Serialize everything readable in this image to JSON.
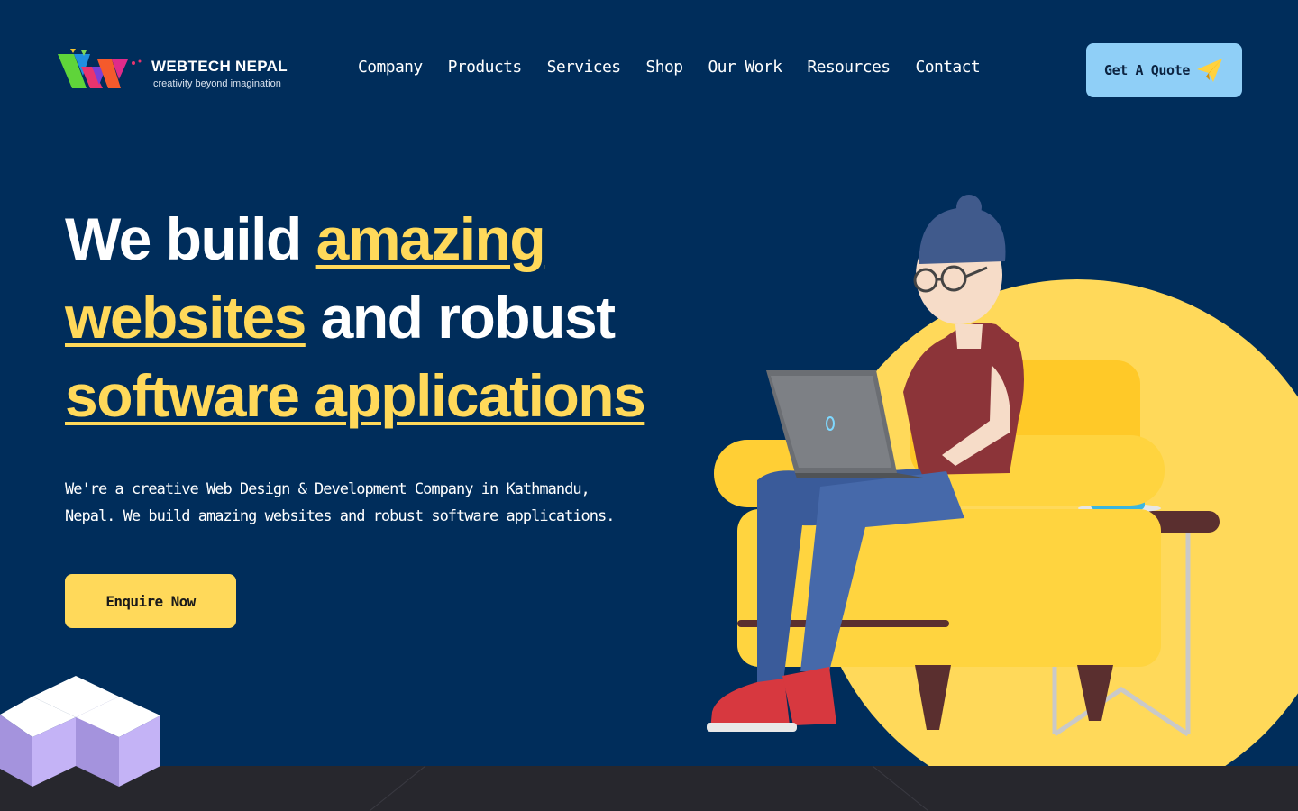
{
  "brand": {
    "name": "WEBTECH NEPAL",
    "tagline": "creativity beyond imagination"
  },
  "nav": {
    "items": [
      "Company",
      "Products",
      "Services",
      "Shop",
      "Our Work",
      "Resources",
      "Contact"
    ]
  },
  "header": {
    "quote_label": "Get A Quote",
    "quote_icon": "paper-plane-icon"
  },
  "hero": {
    "headline": {
      "part1": "We build ",
      "highlight1": "amazing",
      "highlight2": "websites",
      "part2": " and robust",
      "highlight3": "software applications"
    },
    "description": "We're a creative Web Design & Development Company in Kathmandu, Nepal. We build amazing websites and robust software applications.",
    "cta_label": "Enquire Now"
  },
  "colors": {
    "background": "#002d5b",
    "accent_yellow": "#ffd95a",
    "accent_blue": "#8fcff7",
    "footer_band": "#27272d"
  }
}
